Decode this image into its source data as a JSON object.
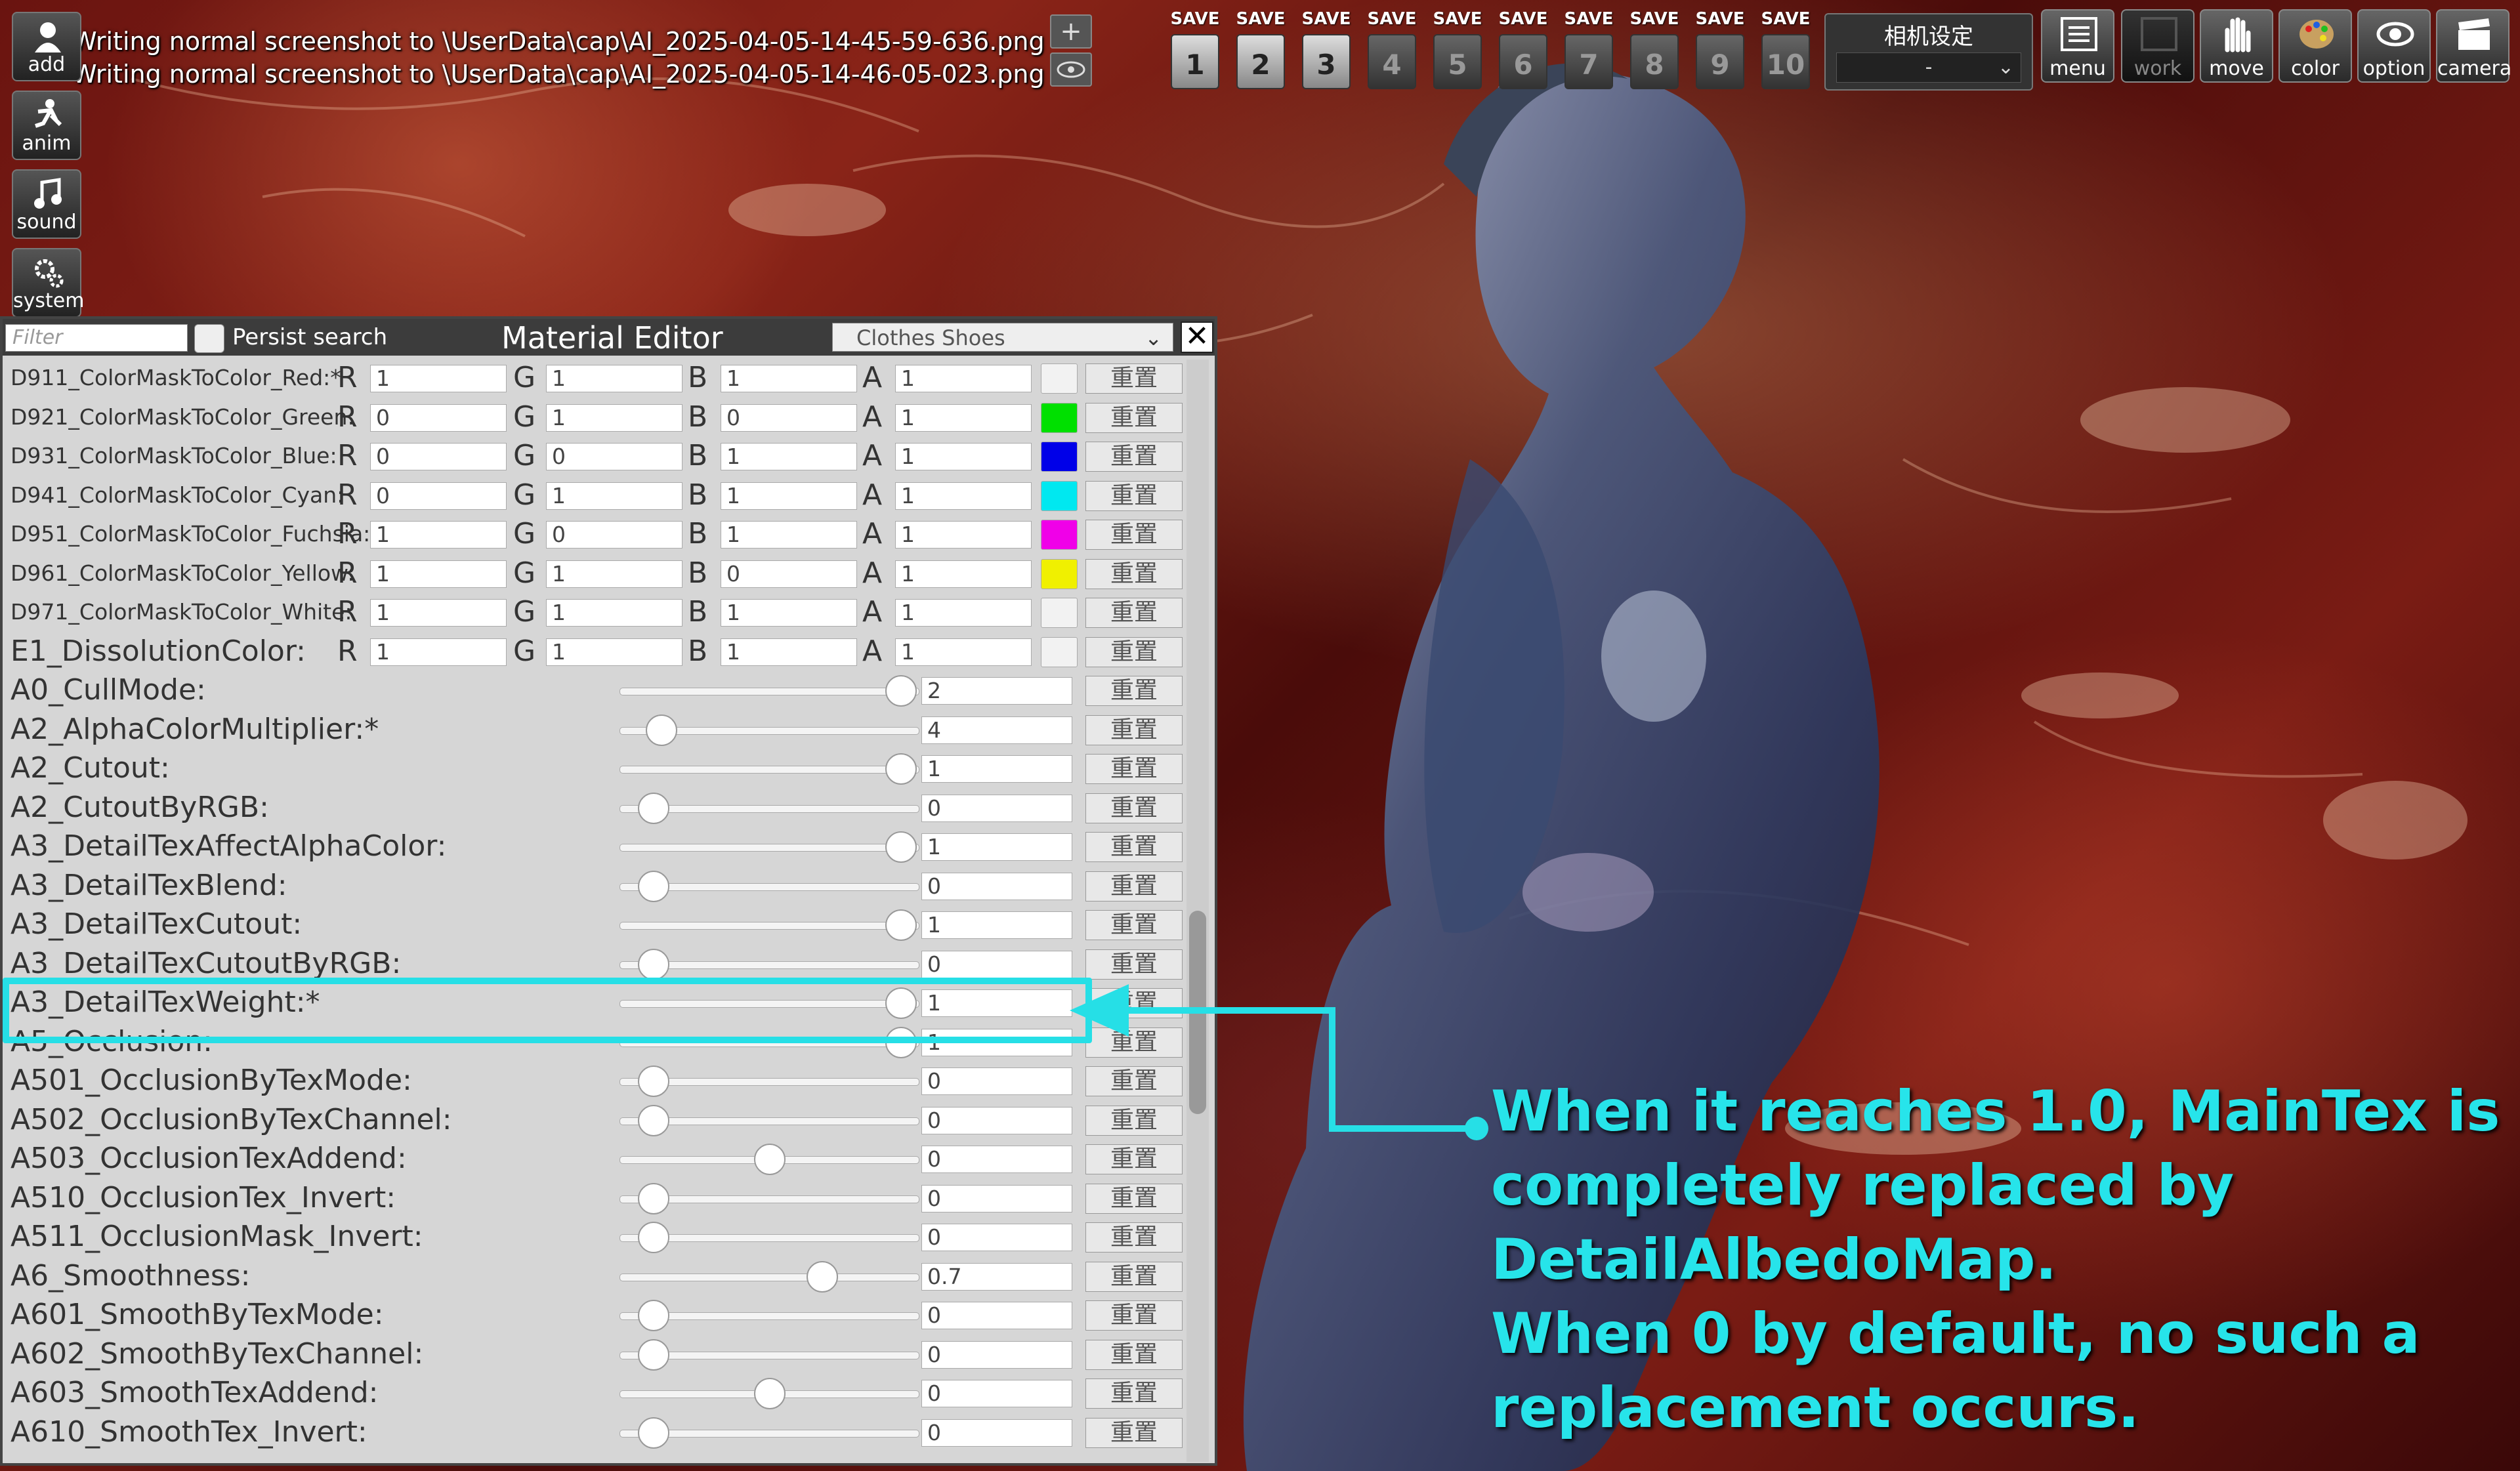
{
  "log": [
    "Writing normal screenshot to \\UserData\\cap\\AI_2025-04-05-14-45-59-636.png",
    "Writing normal screenshot to \\UserData\\cap\\AI_2025-04-05-14-46-05-023.png"
  ],
  "left_tools": [
    {
      "label": "add",
      "icon": "add-character-icon"
    },
    {
      "label": "anim",
      "icon": "animation-icon"
    },
    {
      "label": "sound",
      "icon": "music-note-icon"
    },
    {
      "label": "system",
      "icon": "gears-icon"
    }
  ],
  "zoom": {
    "plus": "+",
    "eye_icon": "eye-icon"
  },
  "save_slots": {
    "label": "SAVE",
    "numbers": [
      "1",
      "2",
      "3",
      "4",
      "5",
      "6",
      "7",
      "8",
      "9",
      "10"
    ]
  },
  "camera_settings": {
    "title": "相机设定",
    "value": "-"
  },
  "top_buttons": [
    "menu",
    "work",
    "move",
    "color",
    "option",
    "camera"
  ],
  "material_editor": {
    "filter_placeholder": "Filter",
    "persist_search": "Persist search",
    "title": "Material Editor",
    "dropdown_value": "Clothes Shoes",
    "close": "✕",
    "reset_label": "重置",
    "color_rows": [
      {
        "name": "D911_ColorMaskToColor_Red:*",
        "r": "1",
        "g": "1",
        "b": "1",
        "a": "1",
        "swatch": "#f2f2f2"
      },
      {
        "name": "D921_ColorMaskToColor_Green:",
        "r": "0",
        "g": "1",
        "b": "0",
        "a": "1",
        "swatch": "#00e000"
      },
      {
        "name": "D931_ColorMaskToColor_Blue:",
        "r": "0",
        "g": "0",
        "b": "1",
        "a": "1",
        "swatch": "#0000e8"
      },
      {
        "name": "D941_ColorMaskToColor_Cyan:",
        "r": "0",
        "g": "1",
        "b": "1",
        "a": "1",
        "swatch": "#00e8f0"
      },
      {
        "name": "D951_ColorMaskToColor_Fuchsia:",
        "r": "1",
        "g": "0",
        "b": "1",
        "a": "1",
        "swatch": "#f000e8"
      },
      {
        "name": "D961_ColorMaskToColor_Yellow:",
        "r": "1",
        "g": "1",
        "b": "0",
        "a": "1",
        "swatch": "#f0f000"
      },
      {
        "name": "D971_ColorMaskToColor_White:",
        "r": "1",
        "g": "1",
        "b": "1",
        "a": "1",
        "swatch": "#f2f2f2"
      },
      {
        "name": "E1_DissolutionColor:",
        "r": "1",
        "g": "1",
        "b": "1",
        "a": "1",
        "swatch": "#f2f2f2"
      }
    ],
    "float_rows": [
      {
        "name": "A0_CullMode:",
        "value": "2",
        "slider": 1.0
      },
      {
        "name": "A2_AlphaColorMultiplier:*",
        "value": "4",
        "slider": 0.09
      },
      {
        "name": "A2_Cutout:",
        "value": "1",
        "slider": 1.0
      },
      {
        "name": "A2_CutoutByRGB:",
        "value": "0",
        "slider": 0.06
      },
      {
        "name": "A3_DetailTexAffectAlphaColor:",
        "value": "1",
        "slider": 1.0
      },
      {
        "name": "A3_DetailTexBlend:",
        "value": "0",
        "slider": 0.06
      },
      {
        "name": "A3_DetailTexCutout:",
        "value": "1",
        "slider": 1.0
      },
      {
        "name": "A3_DetailTexCutoutByRGB:",
        "value": "0",
        "slider": 0.06
      },
      {
        "name": "A3_DetailTexWeight:*",
        "value": "1",
        "slider": 1.0
      },
      {
        "name": "A5_Occlusion:",
        "value": "1",
        "slider": 1.0
      },
      {
        "name": "A501_OcclusionByTexMode:",
        "value": "0",
        "slider": 0.06
      },
      {
        "name": "A502_OcclusionByTexChannel:",
        "value": "0",
        "slider": 0.06
      },
      {
        "name": "A503_OcclusionTexAddend:",
        "value": "0",
        "slider": 0.5
      },
      {
        "name": "A510_OcclusionTex_Invert:",
        "value": "0",
        "slider": 0.06
      },
      {
        "name": "A511_OcclusionMask_Invert:",
        "value": "0",
        "slider": 0.06
      },
      {
        "name": "A6_Smoothness:",
        "value": "0.7",
        "slider": 0.7
      },
      {
        "name": "A601_SmoothByTexMode:",
        "value": "0",
        "slider": 0.06
      },
      {
        "name": "A602_SmoothByTexChannel:",
        "value": "0",
        "slider": 0.06
      },
      {
        "name": "A603_SmoothTexAddend:",
        "value": "0",
        "slider": 0.5
      },
      {
        "name": "A610_SmoothTex_Invert:",
        "value": "0",
        "slider": 0.06
      }
    ]
  },
  "annotation": {
    "lines": [
      "When it reaches 1.0, MainTex is",
      "completely replaced by",
      "DetailAlbedoMap.",
      "When 0 by default, no such a",
      "replacement occurs."
    ],
    "color": "#27e4ea"
  }
}
